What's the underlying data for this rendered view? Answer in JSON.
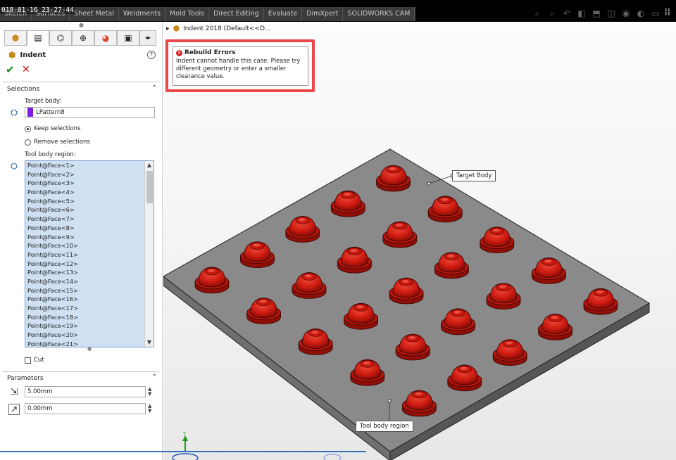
{
  "recording_timestamp": "018-01-16_23-27-44",
  "command_tabs": [
    "Sketch",
    "Surfaces",
    "Sheet Metal",
    "Weldments",
    "Mold Tools",
    "Direct Editing",
    "Evaluate",
    "DimXpert",
    "SOLIDWORKS CAM"
  ],
  "view_toolbar_icons": [
    "search-icon",
    "zoom-area-icon",
    "previous-view-icon",
    "section-view-icon",
    "view-orientation-icon",
    "display-style-icon",
    "hide-show-icon",
    "appearance-icon",
    "display-settings-icon"
  ],
  "property_manager": {
    "tabs": [
      "feature-manager-icon",
      "property-manager-icon",
      "configuration-manager-icon",
      "dimxpert-icon",
      "display-manager-icon"
    ],
    "feature_name": "Indent",
    "help_label": "?",
    "ok_label": "✔",
    "cancel_label": "✕",
    "selections": {
      "title": "Selections",
      "target_body_label": "Target body:",
      "target_body_value": "LPattern8",
      "target_color": "#7c1de0",
      "keep_label": "Keep selections",
      "remove_label": "Remove selections",
      "keep_selected": true,
      "tool_region_label": "Tool body region:",
      "tool_region_items": [
        "Point@Face<1>",
        "Point@Face<2>",
        "Point@Face<3>",
        "Point@Face<4>",
        "Point@Face<5>",
        "Point@Face<6>",
        "Point@Face<7>",
        "Point@Face<8>",
        "Point@Face<9>",
        "Point@Face<10>",
        "Point@Face<11>",
        "Point@Face<12>",
        "Point@Face<13>",
        "Point@Face<14>",
        "Point@Face<15>",
        "Point@Face<16>",
        "Point@Face<17>",
        "Point@Face<18>",
        "Point@Face<19>",
        "Point@Face<20>",
        "Point@Face<21>"
      ],
      "cut_label": "Cut",
      "cut_checked": false
    },
    "parameters": {
      "title": "Parameters",
      "thickness": "5.00mm",
      "clearance": "0.00mm"
    }
  },
  "viewport": {
    "tree_label": "Indent 2018  (Default<<D...",
    "error": {
      "title": "Rebuild Errors",
      "message": "Indent cannot handle this case.  Please try different geometry or enter a smaller clearance value."
    },
    "callouts": {
      "target_body": "Target Body",
      "tool_body": "Tool body region"
    },
    "plate_color": "#8a8a8a",
    "dome_color": "#cc1a10"
  }
}
